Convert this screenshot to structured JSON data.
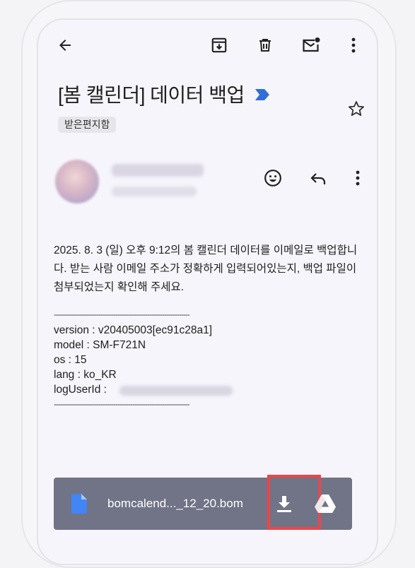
{
  "email": {
    "subject": "[봄 캘린더] 데이터 백업",
    "label": "받은편지함",
    "body": "2025. 8. 3 (일) 오후 9:12의 봄 캘린더 데이터를 이메일로 백업합니다. 받는 사람 이메일 주소가 정확하게 입력되어있는지, 백업 파일이 첨부되었는지 확인해 주세요.",
    "divider": "----------------------------------------------------------------",
    "meta": {
      "version": "version : v20405003[ec91c28a1]",
      "model": "model : SM-F721N",
      "os": "os : 15",
      "lang": "lang : ko_KR",
      "log_user_id": "logUserId :"
    }
  },
  "attachment": {
    "filename": "bomcalend..._12_20.bom"
  },
  "icons": {
    "back": "arrow-left-icon",
    "archive": "archive-icon",
    "delete": "trash-icon",
    "mark_unread": "mail-unread-icon",
    "more": "more-vert-icon",
    "important": "important-marker-icon",
    "star": "star-icon",
    "emoji": "emoji-icon",
    "reply": "reply-icon",
    "file": "file-icon",
    "download": "download-icon",
    "drive": "drive-icon"
  },
  "colors": {
    "accent_blue": "#2f6fd6",
    "attachment_bg": "#717386",
    "highlight": "#e8474a"
  }
}
